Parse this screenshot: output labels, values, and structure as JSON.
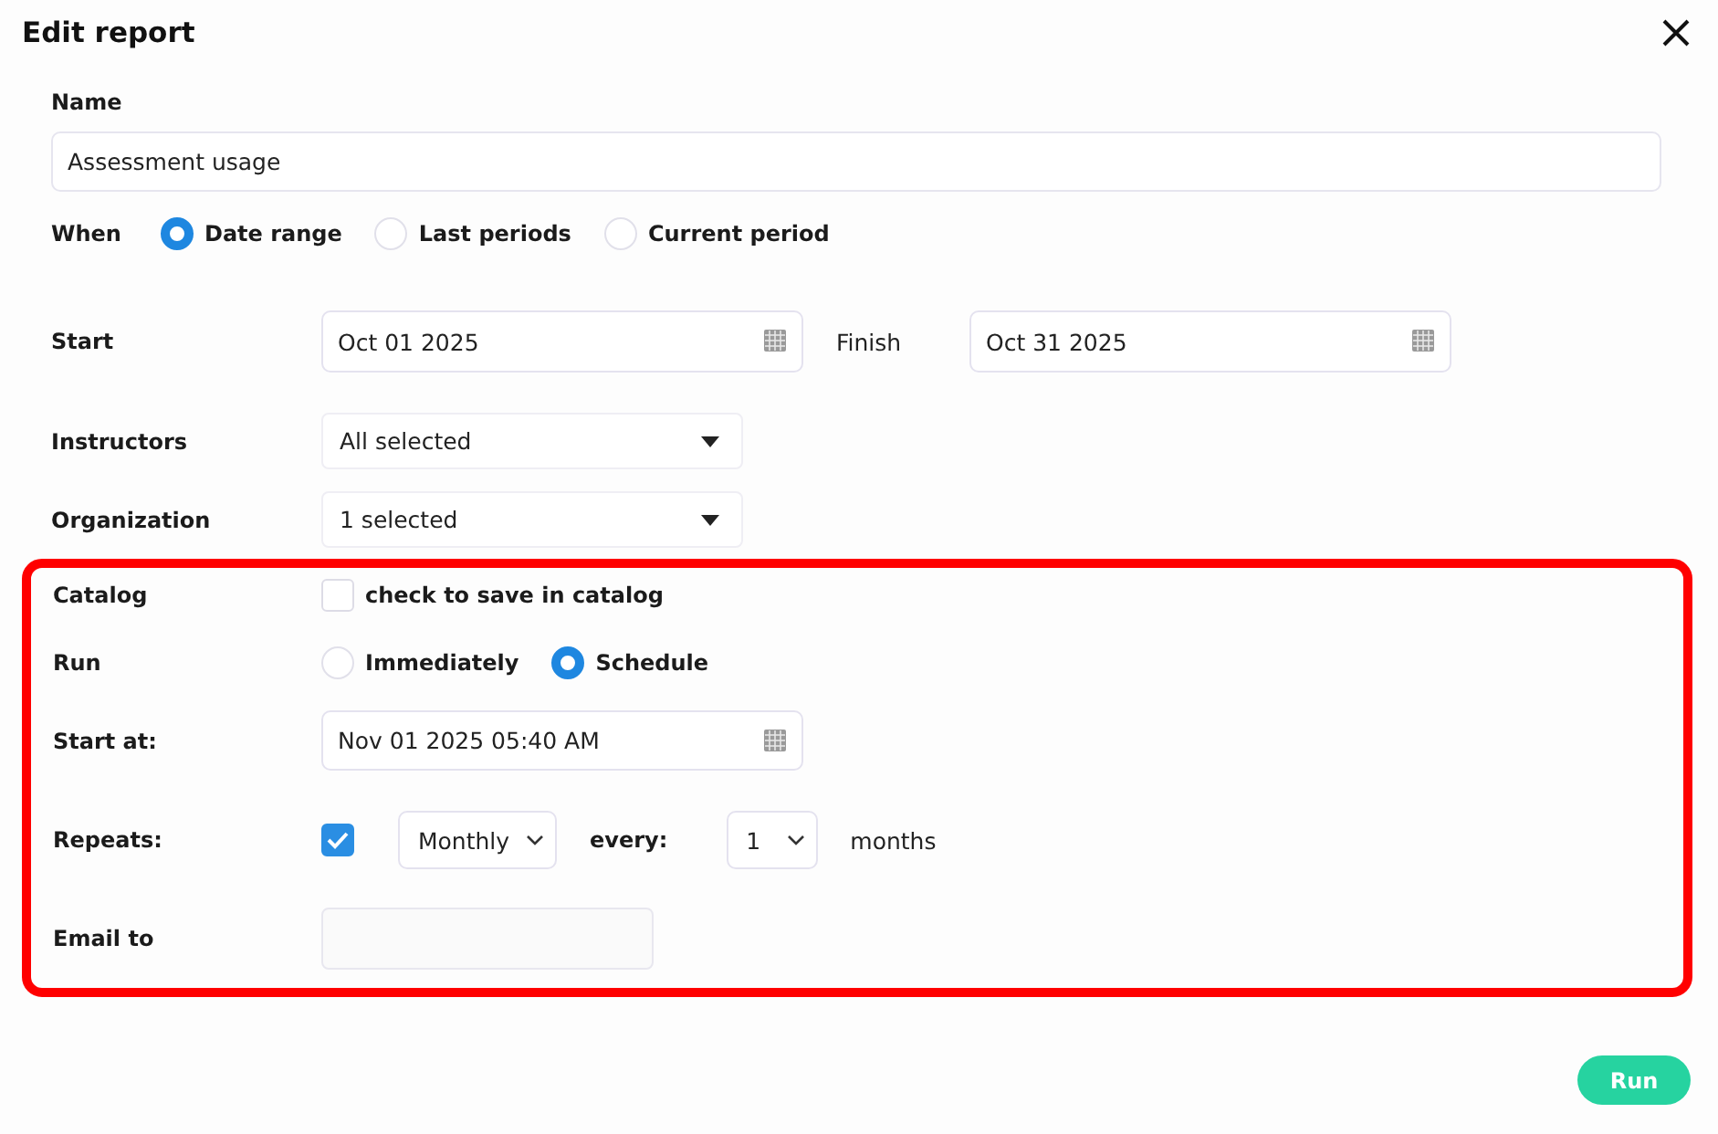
{
  "dialog": {
    "title": "Edit report"
  },
  "name": {
    "label": "Name",
    "value": "Assessment usage"
  },
  "when": {
    "label": "When",
    "options": [
      {
        "label": "Date range",
        "selected": true
      },
      {
        "label": "Last periods",
        "selected": false
      },
      {
        "label": "Current period",
        "selected": false
      }
    ]
  },
  "dates": {
    "start": {
      "label": "Start",
      "value": "Oct 01 2025"
    },
    "finish": {
      "label": "Finish",
      "value": "Oct 31 2025"
    }
  },
  "filters": [
    {
      "label": "Instructors",
      "value": "All selected"
    },
    {
      "label": "Organization",
      "value": "1 selected"
    }
  ],
  "highlighted_section": {
    "catalog": {
      "label": "Catalog",
      "checked": false,
      "text": "check to save in catalog"
    },
    "run": {
      "label": "Run",
      "options": [
        {
          "label": "Immediately",
          "selected": false
        },
        {
          "label": "Schedule",
          "selected": true
        }
      ]
    },
    "start_at": {
      "label": "Start at:",
      "value": "Nov 01 2025 05:40 AM"
    },
    "repeats": {
      "label": "Repeats:",
      "checked": true,
      "frequency": "Monthly",
      "every_label": "every:",
      "interval": "1",
      "unit": "months"
    },
    "email_to": {
      "label": "Email to"
    }
  },
  "run_button": {
    "label": "Run"
  }
}
